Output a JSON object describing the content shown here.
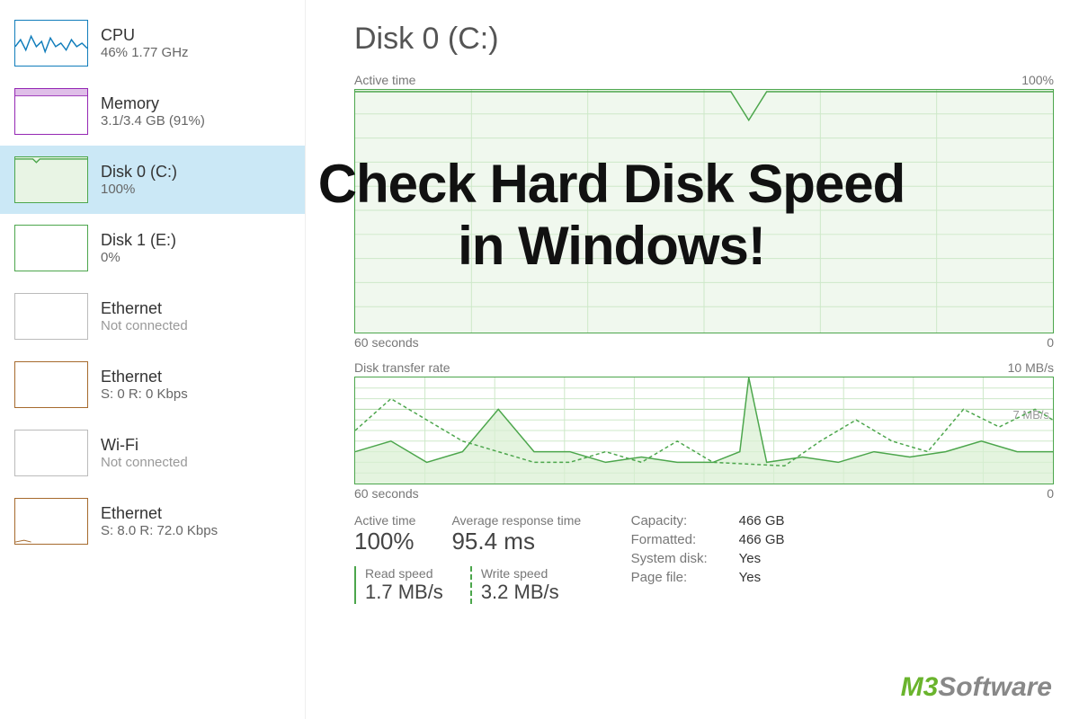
{
  "sidebar": {
    "items": [
      {
        "title": "CPU",
        "sub": "46%  1.77 GHz",
        "type": "cpu",
        "disabled": false
      },
      {
        "title": "Memory",
        "sub": "3.1/3.4 GB (91%)",
        "type": "mem",
        "disabled": false
      },
      {
        "title": "Disk 0 (C:)",
        "sub": "100%",
        "type": "disk",
        "selected": true,
        "disabled": false
      },
      {
        "title": "Disk 1 (E:)",
        "sub": "0%",
        "type": "disk",
        "disabled": false
      },
      {
        "title": "Ethernet",
        "sub": "Not connected",
        "type": "eth",
        "disabled": true
      },
      {
        "title": "Ethernet",
        "sub": "S: 0 R: 0 Kbps",
        "type": "eth",
        "disabled": false
      },
      {
        "title": "Wi-Fi",
        "sub": "Not connected",
        "type": "wifi",
        "disabled": true
      },
      {
        "title": "Ethernet",
        "sub": "S: 8.0  R: 72.0 Kbps",
        "type": "eth",
        "disabled": false
      }
    ]
  },
  "main": {
    "title": "Disk 0 (C:)",
    "active_time_label": "Active time",
    "active_time_max": "100%",
    "axis_left": "60 seconds",
    "axis_right": "0",
    "transfer_label": "Disk transfer rate",
    "transfer_max": "10 MB/s",
    "transfer_mid": "7 MB/s",
    "stats": {
      "active_time_label": "Active time",
      "active_time_value": "100%",
      "avg_resp_label": "Average response time",
      "avg_resp_value": "95.4 ms",
      "read_label": "Read speed",
      "read_value": "1.7 MB/s",
      "write_label": "Write speed",
      "write_value": "3.2 MB/s"
    },
    "info": {
      "capacity_label": "Capacity:",
      "capacity_value": "466 GB",
      "formatted_label": "Formatted:",
      "formatted_value": "466 GB",
      "system_label": "System disk:",
      "system_value": "Yes",
      "page_label": "Page file:",
      "page_value": "Yes"
    }
  },
  "overlay": {
    "line1": "Check Hard Disk Speed",
    "line2": "in Windows!"
  },
  "logo": {
    "brand": "M3",
    "suffix": "Software"
  },
  "chart_data": [
    {
      "type": "line",
      "title": "Active time",
      "xlabel": "seconds",
      "ylabel": "%",
      "xlim": [
        0,
        60
      ],
      "ylim": [
        0,
        100
      ],
      "x": [
        0,
        5,
        10,
        15,
        20,
        25,
        30,
        32,
        34,
        36,
        38,
        40,
        45,
        50,
        55,
        60
      ],
      "values": [
        100,
        100,
        100,
        100,
        100,
        100,
        100,
        100,
        88,
        100,
        100,
        100,
        100,
        100,
        100,
        100
      ]
    },
    {
      "type": "line",
      "title": "Disk transfer rate",
      "xlabel": "seconds",
      "ylabel": "MB/s",
      "xlim": [
        0,
        60
      ],
      "ylim": [
        0,
        10
      ],
      "series": [
        {
          "name": "Read",
          "x": [
            0,
            3,
            6,
            9,
            12,
            15,
            18,
            21,
            24,
            27,
            30,
            33,
            34,
            36,
            39,
            42,
            45,
            48,
            51,
            54,
            57,
            60
          ],
          "values": [
            3,
            4,
            2,
            3,
            7,
            3,
            3,
            2,
            2.5,
            2,
            2,
            3,
            10,
            2,
            2.5,
            2,
            3,
            2.5,
            3,
            4,
            3,
            3
          ]
        },
        {
          "name": "Write",
          "x": [
            0,
            3,
            6,
            9,
            12,
            15,
            18,
            21,
            24,
            27,
            30,
            33,
            36,
            39,
            42,
            45,
            48,
            51,
            54,
            57,
            60
          ],
          "values": [
            5,
            8,
            6,
            4,
            3,
            2,
            2,
            3,
            2,
            4,
            2,
            2,
            1.5,
            4,
            6,
            4,
            3,
            7,
            5,
            7,
            6
          ]
        }
      ]
    }
  ]
}
